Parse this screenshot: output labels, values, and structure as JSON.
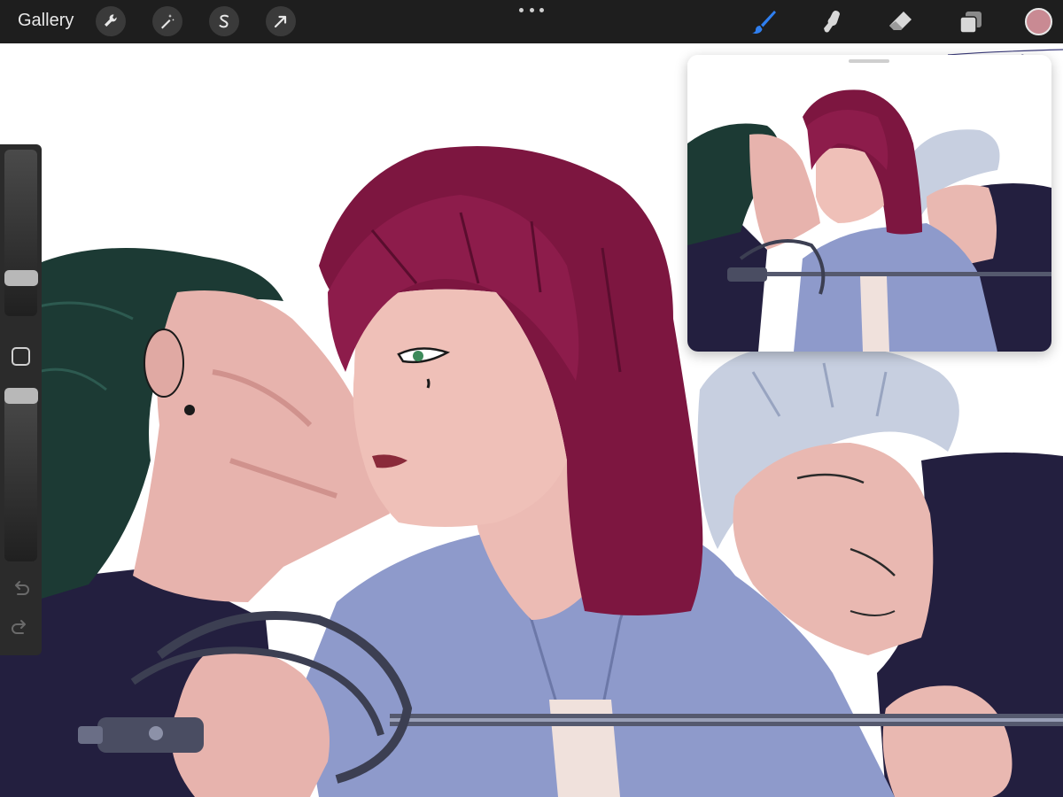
{
  "toolbar": {
    "gallery_label": "Gallery",
    "left_tools": [
      "wrench-icon",
      "magic-wand-icon",
      "selection-s-icon",
      "transform-arrow-icon"
    ],
    "right_tools": [
      "brush-icon",
      "smudge-icon",
      "eraser-icon",
      "layers-icon"
    ],
    "active_tool": "brush",
    "active_tool_color": "#2f7ff0",
    "current_color": "#c98a93"
  },
  "sidebar": {
    "brush_size_level": 0.2,
    "opacity_level": 1.0
  },
  "reference": {
    "window": "reference-image"
  },
  "colors": {
    "hair_red": "#7d1640",
    "hair_dark": "#1c3a34",
    "hair_silver": "#c7cfe0",
    "shirt": "#8e9acb",
    "skin": "#eab8b1",
    "dark_cloth": "#231f3f"
  }
}
